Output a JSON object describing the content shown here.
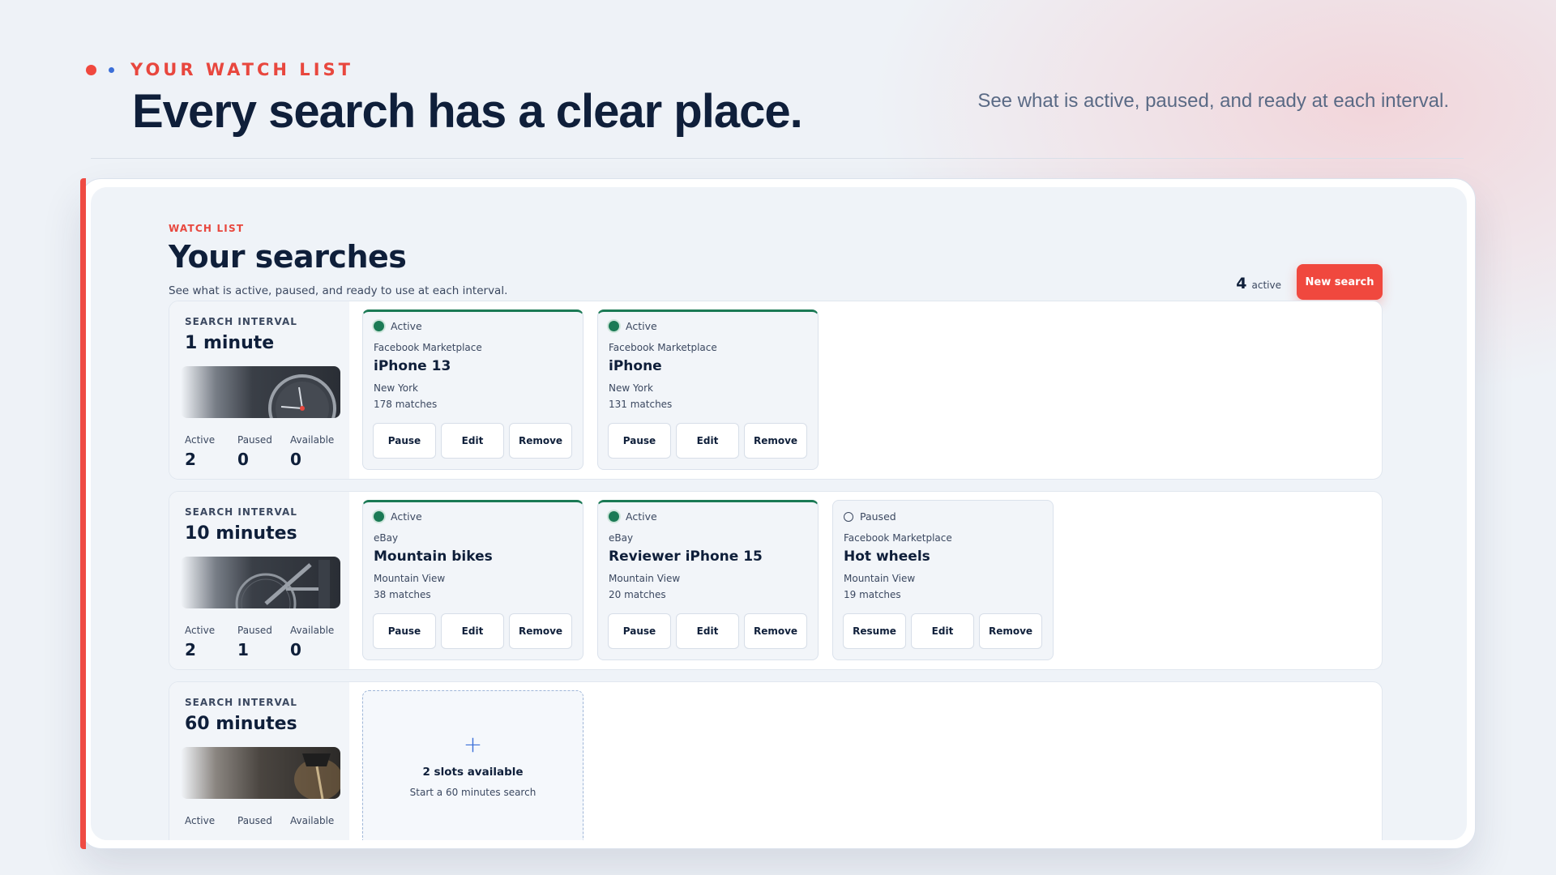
{
  "hero": {
    "eyebrow": "YOUR WATCH LIST",
    "title": "Every search has a clear place.",
    "subtitle": "See what is active, paused, and ready at each interval."
  },
  "page": {
    "eyebrow": "WATCH LIST",
    "title": "Your searches",
    "subtitle": "See what is active, paused, and ready to use at each interval.",
    "active_count": "4",
    "active_label": "active",
    "new_search_label": "New search"
  },
  "colors": {
    "accent": "#f0483e",
    "active_green": "#1b7a55",
    "navy": "#0f1f3a"
  },
  "intervals": [
    {
      "label": "SEARCH INTERVAL",
      "value": "1 minute",
      "thumb_icon": "stopwatch-image",
      "stats": {
        "active_label": "Active",
        "active": "2",
        "paused_label": "Paused",
        "paused": "0",
        "available_label": "Available",
        "available": "0"
      },
      "cards": [
        {
          "status": "Active",
          "platform": "Facebook Marketplace",
          "title": "iPhone 13",
          "location": "New York",
          "matches": "178 matches",
          "btn1": "Pause",
          "btn2": "Edit",
          "btn3": "Remove"
        },
        {
          "status": "Active",
          "platform": "Facebook Marketplace",
          "title": "iPhone",
          "location": "New York",
          "matches": "131 matches",
          "btn1": "Pause",
          "btn2": "Edit",
          "btn3": "Remove"
        }
      ]
    },
    {
      "label": "SEARCH INTERVAL",
      "value": "10 minutes",
      "thumb_icon": "bicycle-image",
      "stats": {
        "active_label": "Active",
        "active": "2",
        "paused_label": "Paused",
        "paused": "1",
        "available_label": "Available",
        "available": "0"
      },
      "cards": [
        {
          "status": "Active",
          "platform": "eBay",
          "title": "Mountain bikes",
          "location": "Mountain View",
          "matches": "38 matches",
          "btn1": "Pause",
          "btn2": "Edit",
          "btn3": "Remove"
        },
        {
          "status": "Active",
          "platform": "eBay",
          "title": "Reviewer iPhone 15",
          "location": "Mountain View",
          "matches": "20 matches",
          "btn1": "Pause",
          "btn2": "Edit",
          "btn3": "Remove"
        },
        {
          "status": "Paused",
          "platform": "Facebook Marketplace",
          "title": "Hot wheels",
          "location": "Mountain View",
          "matches": "19 matches",
          "btn1": "Resume",
          "btn2": "Edit",
          "btn3": "Remove"
        }
      ]
    },
    {
      "label": "SEARCH INTERVAL",
      "value": "60 minutes",
      "thumb_icon": "lamp-image",
      "stats": {
        "active_label": "Active",
        "paused_label": "Paused",
        "available_label": "Available"
      },
      "slot": {
        "title": "2 slots available",
        "subtitle": "Start a 60 minutes search"
      }
    }
  ]
}
